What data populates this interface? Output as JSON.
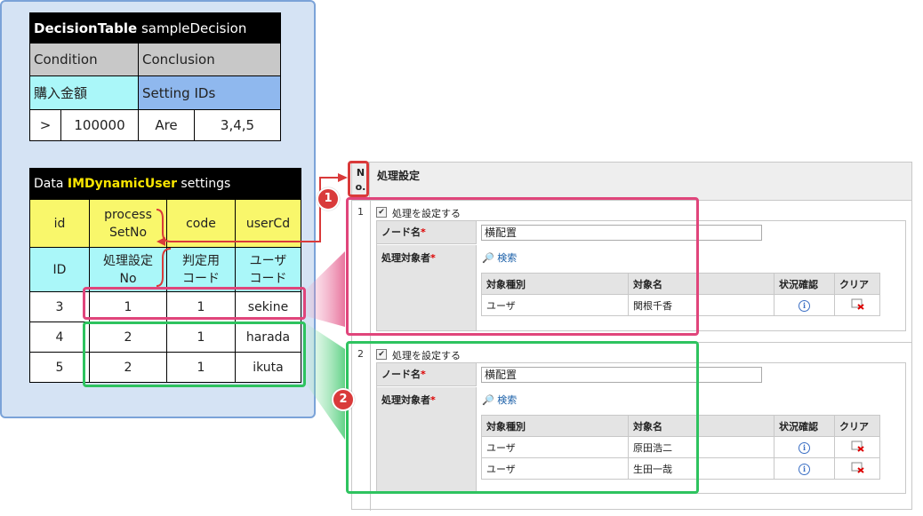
{
  "decision_table": {
    "title_bold": "DecisionTable",
    "title_rest": " sampleDecision",
    "condition_header": "Condition",
    "conclusion_header": "Conclusion",
    "condition_field": "購入金額",
    "conclusion_field": "Setting IDs",
    "row": {
      "operator": ">",
      "value": "100000",
      "verb": "Are",
      "ids": "3,4,5"
    }
  },
  "data_table": {
    "title_pre": "Data ",
    "title_name": "IMDynamicUser",
    "title_post": " settings",
    "headers_en": [
      "id",
      "process\nSetNo",
      "code",
      "userCd"
    ],
    "headers_ja": [
      "ID",
      "処理設定\nNo",
      "判定用\nコード",
      "ユーザ\nコード"
    ],
    "rows": [
      [
        "3",
        "1",
        "1",
        "sekine"
      ],
      [
        "4",
        "2",
        "1",
        "harada"
      ],
      [
        "5",
        "2",
        "1",
        "ikuta"
      ]
    ]
  },
  "form": {
    "no_header": "N\no.",
    "title": "処理設定",
    "checkbox_label": "処理を設定する",
    "node_label": "ノード名",
    "target_label": "処理対象者",
    "required_mark": "*",
    "search_label": "検索",
    "columns": [
      "対象種別",
      "対象名",
      "状況確認",
      "クリア"
    ],
    "check_mark": "✔",
    "info_glyph": "i",
    "entries": [
      {
        "number": "1",
        "node_name": "横配置",
        "targets": [
          {
            "type": "ユーザ",
            "name": "関根千香"
          }
        ]
      },
      {
        "number": "2",
        "node_name": "横配置",
        "targets": [
          {
            "type": "ユーザ",
            "name": "原田浩二"
          },
          {
            "type": "ユーザ",
            "name": "生田一哉"
          }
        ]
      }
    ]
  },
  "callouts": {
    "badge1": "1",
    "badge2": "2"
  },
  "colors": {
    "pink_highlight": "#e0457b",
    "green_highlight": "#2ec35f",
    "red_marker": "#d93a3a",
    "panel_blue": "#d5e3f4",
    "cyan_cell": "#aaf7f9",
    "yellow_cell": "#f9f76b"
  }
}
